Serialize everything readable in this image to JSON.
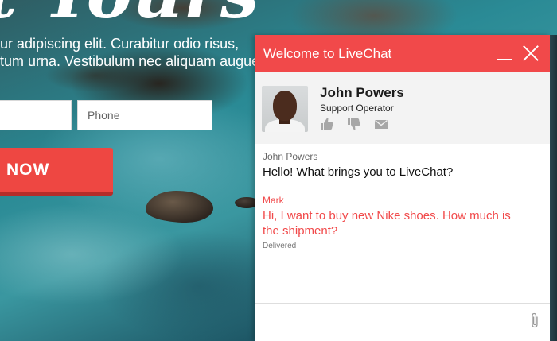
{
  "website": {
    "hero_title": "t Tours",
    "hero_text_line1": "ur adipiscing elit. Curabitur odio risus,",
    "hero_text_line2": "tum urna. Vestibulum nec aliquam augue.",
    "phone_placeholder": "Phone",
    "cta_label": "NOW"
  },
  "chat": {
    "header_title": "Welcome to LiveChat",
    "minimize_icon": "minimize-icon",
    "close_icon": "close-icon",
    "agent": {
      "name": "John Powers",
      "role": "Support Operator",
      "rating_icons": [
        "thumbs-up-icon",
        "thumbs-down-icon",
        "envelope-icon"
      ]
    },
    "messages": [
      {
        "author": "John Powers",
        "text": "Hello! What brings you to LiveChat?"
      },
      {
        "author": "Mark",
        "text": "Hi, I want to buy new Nike shoes. How much is the shipment?",
        "status": "Delivered"
      }
    ],
    "composer": {
      "attach_icon": "paperclip-icon"
    }
  },
  "colors": {
    "accent": "#f1494a",
    "cta": "#ee4742",
    "agent_card_bg": "#f3f3f3"
  }
}
